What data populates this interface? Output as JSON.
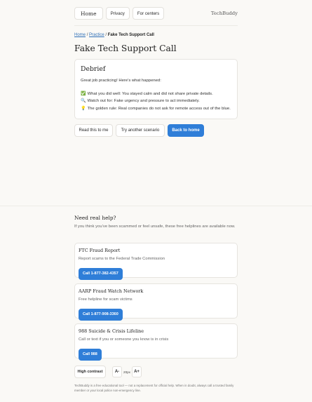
{
  "header": {
    "nav": [
      "Home",
      "Privacy",
      "For centers"
    ],
    "brand": "TechBuddy"
  },
  "breadcrumb": {
    "home": "Home",
    "practice": "Practice",
    "current": "Fake Tech Support Call"
  },
  "page_title": "Fake Tech Support Call",
  "debrief": {
    "heading": "Debrief",
    "intro": "Great job practicing! Here’s what happened:",
    "points": [
      {
        "icon": "✅",
        "icon_name": "check-mark-icon",
        "text": "What you did well: You stayed calm and did not share private details."
      },
      {
        "icon": "🔍",
        "icon_name": "magnifier-icon",
        "text": "Watch out for: Fake urgency and pressure to act immediately."
      },
      {
        "icon": "💡",
        "icon_name": "light-bulb-icon",
        "text": "The golden rule: Real companies do not ask for remote access out of the blue."
      }
    ]
  },
  "actions": {
    "read": "Read this to me",
    "another": "Try another scenario",
    "back": "Back to home"
  },
  "help": {
    "title": "Need real help?",
    "desc": "If you think you’ve been scammed or feel unsafe, these free helplines are available now.",
    "lines": [
      {
        "name": "FTC Fraud Report",
        "sub": "Report scams to the Federal Trade Commission",
        "button": "Call 1-877-382-4357"
      },
      {
        "name": "AARP Fraud Watch Network",
        "sub": "Free helpline for scam victims",
        "button": "Call 1-877-908-3360"
      },
      {
        "name": "988 Suicide & Crisis Lifeline",
        "sub": "Call or text if you or someone you know is in crisis",
        "button": "Call 988"
      }
    ]
  },
  "accessibility": {
    "high_contrast": "High contrast",
    "decrease": "A-",
    "size": "20px",
    "increase": "A+"
  },
  "footer": "TechBuddy is a free educational tool — not a replacement for official help. When in doubt, always call a trusted family member or your local police non-emergency line.",
  "colors": {
    "accent": "#2f7ed8",
    "background": "#faf9f6"
  }
}
